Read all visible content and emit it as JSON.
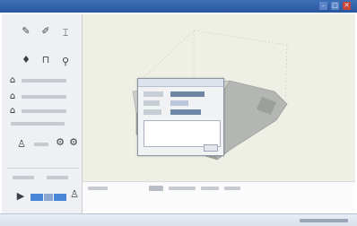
{
  "window": {
    "controls": [
      "–",
      "□",
      "✕"
    ]
  },
  "toolbar_icons": [
    "pen-icon",
    "brush-icon",
    "pin-icon",
    "drop-icon",
    "cup-icon",
    "bottle-icon"
  ],
  "lock_icons": [
    "lock-icon",
    "lock-icon",
    "lock-icon"
  ],
  "tools": {
    "pen": "✎",
    "brush": "✐",
    "pin": "⌶",
    "drop": "♦",
    "cup": "⊓",
    "bottle": "⚲",
    "lock": "⌂",
    "person": "♙",
    "settings": "⚙",
    "run": "▶"
  },
  "colors": {
    "titlebar": "#2a56a0",
    "accent_blue": "#4a86d8",
    "viewport": "#eef0e6",
    "model_gray": "#b4b6b3"
  }
}
